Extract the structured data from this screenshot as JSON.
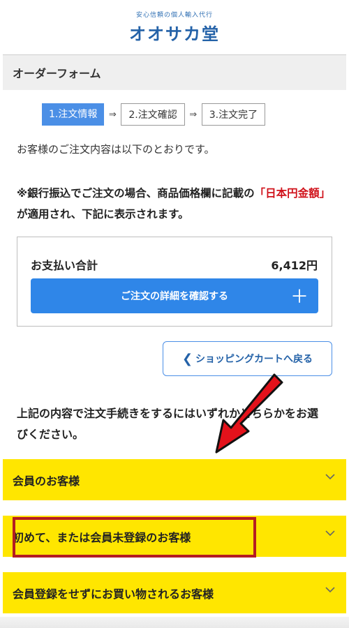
{
  "header": {
    "tagline": "安心信頼の個人輸入代行",
    "brand": "オオサカ堂"
  },
  "form_title": "オーダーフォーム",
  "steps": [
    {
      "label": "1.注文情報",
      "active": true
    },
    {
      "label": "2.注文確認",
      "active": false
    },
    {
      "label": "3.注文完了",
      "active": false
    }
  ],
  "step_separator": "⇒",
  "intro_text": "お客様のご注文内容は以下のとおりです。",
  "notice": {
    "prefix": "※銀行振込でご注文の場合、商品価格欄に記載の",
    "highlight": "「日本円金額」",
    "suffix": "が適用され、下記に表示されます。"
  },
  "summary": {
    "label": "お支払い合計",
    "amount": "6,412円",
    "detail_button": "ご注文の詳細を確認する",
    "detail_icon": "＋"
  },
  "back_button": {
    "icon": "❮",
    "label": "ショッピングカートへ戻る"
  },
  "choose_text": "上記の内容で注文手続きをするにはいずれかどちらかをお選びください。",
  "options": [
    {
      "label": "会員のお客様"
    },
    {
      "label": "初めて、または会員未登録のお客様"
    },
    {
      "label": "会員登録をせずにお買い物されるお客様"
    }
  ],
  "colors": {
    "brand_blue": "#2462a8",
    "button_blue": "#2f86e8",
    "option_yellow": "#ffe600",
    "notice_red": "#d0121b",
    "highlight_red": "#b41d22",
    "arrow_red": "#e3121b"
  }
}
